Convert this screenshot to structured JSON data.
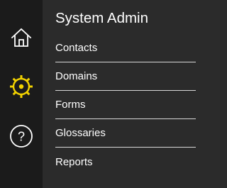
{
  "rail": {
    "items": [
      {
        "icon": "home-icon",
        "active": false
      },
      {
        "icon": "gear-icon",
        "active": true
      },
      {
        "icon": "help-icon",
        "active": false
      }
    ],
    "icon_color": "#ffffff",
    "active_color": "#f2d200"
  },
  "panel": {
    "title": "System Admin",
    "menu": [
      "Contacts",
      "Domains",
      "Forms",
      "Glossaries",
      "Reports"
    ]
  },
  "help_glyph": "?"
}
